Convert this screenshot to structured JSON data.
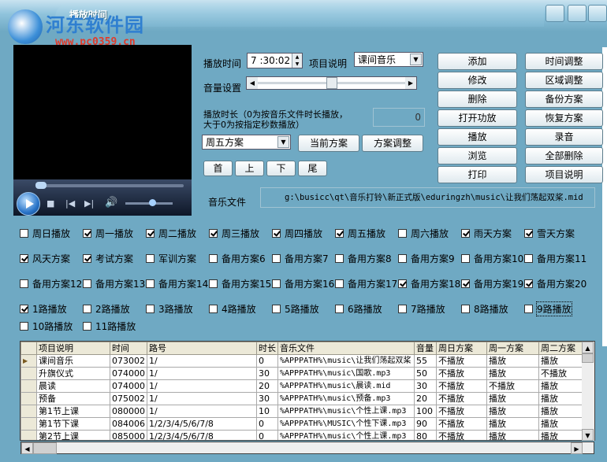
{
  "window": {
    "title": "播放时间"
  },
  "watermark": {
    "site_name": "河东软件园",
    "url": "www.pc0359.cn"
  },
  "form": {
    "play_time_label": "播放时间",
    "play_time_value": "7 :30:02",
    "item_desc_label": "项目说明",
    "item_desc_value": "课间音乐",
    "volume_label": "音量设置",
    "volume_level": 0.5,
    "duration_label_line1": "播放时长（0为按音乐文件时长播放，",
    "duration_label_line2": "大于0为按指定秒数播放）",
    "duration_value": "0",
    "scheme_value": "周五方案",
    "current_scheme_btn": "当前方案",
    "scheme_adjust_btn": "方案调整",
    "first_btn": "首",
    "up_btn": "上",
    "down_btn": "下",
    "last_btn": "尾",
    "music_file_label": "音乐文件",
    "music_file_value": "g:\\busicc\\qt\\音乐打铃\\新正式版\\eduringzh\\music\\让我们荡起双桨.mid"
  },
  "buttons": {
    "add": "添加",
    "modify": "修改",
    "delete": "删除",
    "open_amp": "打开功放",
    "play": "播放",
    "browse": "浏览",
    "print": "打印",
    "time_adjust": "时间调整",
    "zone_adjust": "区域调整",
    "backup_scheme": "备份方案",
    "restore_scheme": "恢复方案",
    "record": "录音",
    "delete_all": "全部删除",
    "item_desc": "项目说明"
  },
  "checkboxes": [
    {
      "label": "周日播放",
      "checked": false
    },
    {
      "label": "周一播放",
      "checked": true
    },
    {
      "label": "周二播放",
      "checked": true
    },
    {
      "label": "周三播放",
      "checked": true
    },
    {
      "label": "周四播放",
      "checked": true
    },
    {
      "label": "周五播放",
      "checked": true
    },
    {
      "label": "周六播放",
      "checked": false
    },
    {
      "label": "雨天方案",
      "checked": true
    },
    {
      "label": "雪天方案",
      "checked": true
    },
    {
      "label": "风天方案",
      "checked": true
    },
    {
      "label": "考试方案",
      "checked": true
    },
    {
      "label": "军训方案",
      "checked": false
    },
    {
      "label": "备用方案6",
      "checked": false
    },
    {
      "label": "备用方案7",
      "checked": false
    },
    {
      "label": "备用方案8",
      "checked": false
    },
    {
      "label": "备用方案9",
      "checked": false
    },
    {
      "label": "备用方案10",
      "checked": false
    },
    {
      "label": "备用方案11",
      "checked": false
    },
    {
      "label": "备用方案12",
      "checked": false
    },
    {
      "label": "备用方案13",
      "checked": false
    },
    {
      "label": "备用方案14",
      "checked": false
    },
    {
      "label": "备用方案15",
      "checked": false
    },
    {
      "label": "备用方案16",
      "checked": false
    },
    {
      "label": "备用方案17",
      "checked": false
    },
    {
      "label": "备用方案18",
      "checked": true
    },
    {
      "label": "备用方案19",
      "checked": true
    },
    {
      "label": "备用方案20",
      "checked": true
    },
    {
      "label": "1路播放",
      "checked": true
    },
    {
      "label": "2路播放",
      "checked": false
    },
    {
      "label": "3路播放",
      "checked": false
    },
    {
      "label": "4路播放",
      "checked": false
    },
    {
      "label": "5路播放",
      "checked": false
    },
    {
      "label": "6路播放",
      "checked": false
    },
    {
      "label": "7路播放",
      "checked": false
    },
    {
      "label": "8路播放",
      "checked": false
    },
    {
      "label": "9路播放",
      "checked": false
    },
    {
      "label": "10路播放",
      "checked": false
    },
    {
      "label": "11路播放",
      "checked": false
    }
  ],
  "table": {
    "columns": [
      "项目说明",
      "时间",
      "路号",
      "时长",
      "音乐文件",
      "音量",
      "周日方案",
      "周一方案",
      "周二方案"
    ],
    "rows": [
      [
        "课间音乐",
        "073002",
        "1/",
        "0",
        "%APPPATH%\\music\\让我们荡起双桨",
        "55",
        "不播放",
        "播放",
        "播放"
      ],
      [
        "升旗仪式",
        "074000",
        "1/",
        "30",
        "%APPPATH%\\music\\国歌.mp3",
        "50",
        "不播放",
        "播放",
        "不播放"
      ],
      [
        "晨读",
        "074000",
        "1/",
        "20",
        "%APPPATH%\\music\\晨读.mid",
        "30",
        "不播放",
        "不播放",
        "播放"
      ],
      [
        "预备",
        "075002",
        "1/",
        "30",
        "%APPPATH%\\music\\预备.mp3",
        "20",
        "不播放",
        "播放",
        "播放"
      ],
      [
        "第1节上课",
        "080000",
        "1/",
        "10",
        "%APPPATH%\\music\\个性上课.mp3",
        "100",
        "不播放",
        "播放",
        "播放"
      ],
      [
        "第1节下课",
        "084006",
        "1/2/3/4/5/6/7/8",
        "0",
        "%APPPATH%\\MUSIC\\个性下课.mp3",
        "90",
        "不播放",
        "播放",
        "播放"
      ],
      [
        "第2节上课",
        "085000",
        "1/2/3/4/5/6/7/8",
        "0",
        "%APPPATH%\\music\\个性上课.mp3",
        "80",
        "不播放",
        "播放",
        "播放"
      ]
    ]
  }
}
